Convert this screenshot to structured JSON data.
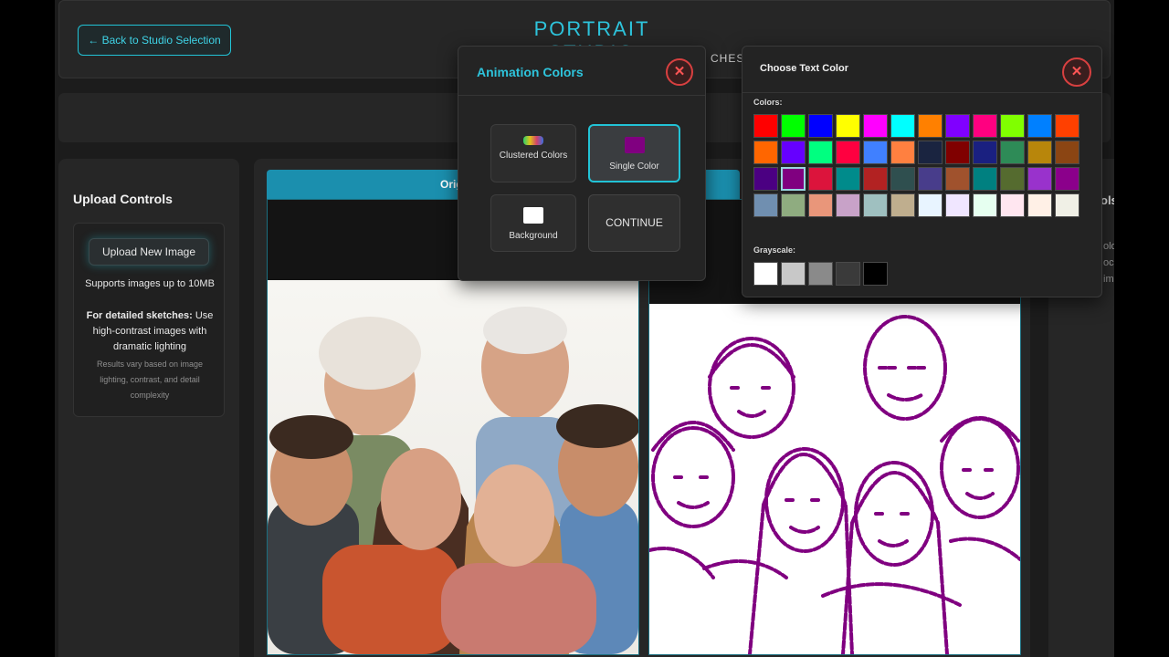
{
  "header": {
    "back_label": "← Back to Studio Selection",
    "title": "PORTRAIT STUDIO",
    "nav_fragment": "CHES"
  },
  "sidebar": {
    "title": "Upload Controls",
    "upload_button": "Upload New Image",
    "supports": "Supports images up to 10MB",
    "tip_bold": "For detailed sketches:",
    "tip_text": " Use high-contrast images with dramatic lighting",
    "note": "Results vary based on image lighting, contrast, and detail complexity"
  },
  "main": {
    "original_header": "Origi",
    "right_fragment_1": "ols",
    "right_fragments": [
      "olo",
      "oc",
      "im"
    ]
  },
  "animation_popup": {
    "title": "Animation Colors",
    "options": {
      "clustered": "Clustered Colors",
      "single": "Single Color",
      "background": "Background"
    },
    "continue_label": "CONTINUE",
    "single_color": "#800080"
  },
  "color_picker": {
    "title": "Choose Text Color",
    "colors_label": "Colors:",
    "grayscale_label": "Grayscale:",
    "selected": "#800080",
    "colors": [
      [
        "#ff0000",
        "#00ff00",
        "#0000ff",
        "#ffff00",
        "#ff00ff",
        "#00ffff",
        "#ff8000",
        "#8000ff",
        "#ff0080",
        "#80ff00",
        "#0080ff",
        "#ff4000"
      ],
      [
        "#ff6600",
        "#6600ff",
        "#00ff80",
        "#ff0040",
        "#4080ff",
        "#ff8040",
        "#1a2440",
        "#800000",
        "#1a2080",
        "#2e8b57",
        "#b8860b",
        "#8b4513"
      ],
      [
        "#4b0082",
        "#800080",
        "#dc143c",
        "#008b8b",
        "#b22222",
        "#2f4f4f",
        "#483d8b",
        "#a0522d",
        "#008080",
        "#556b2f",
        "#9932cc",
        "#8b008b"
      ],
      [
        "#708fb0",
        "#8fac80",
        "#e9967a",
        "#c8a2c8",
        "#9fc0c0",
        "#bfae8e",
        "#e8f4ff",
        "#f0e6ff",
        "#e6fff0",
        "#ffe6f0",
        "#fff0e6",
        "#f0f0e6"
      ]
    ],
    "grayscale": [
      "#ffffff",
      "#c8c8c8",
      "#8a8a8a",
      "#3a3a3a",
      "#000000"
    ]
  }
}
